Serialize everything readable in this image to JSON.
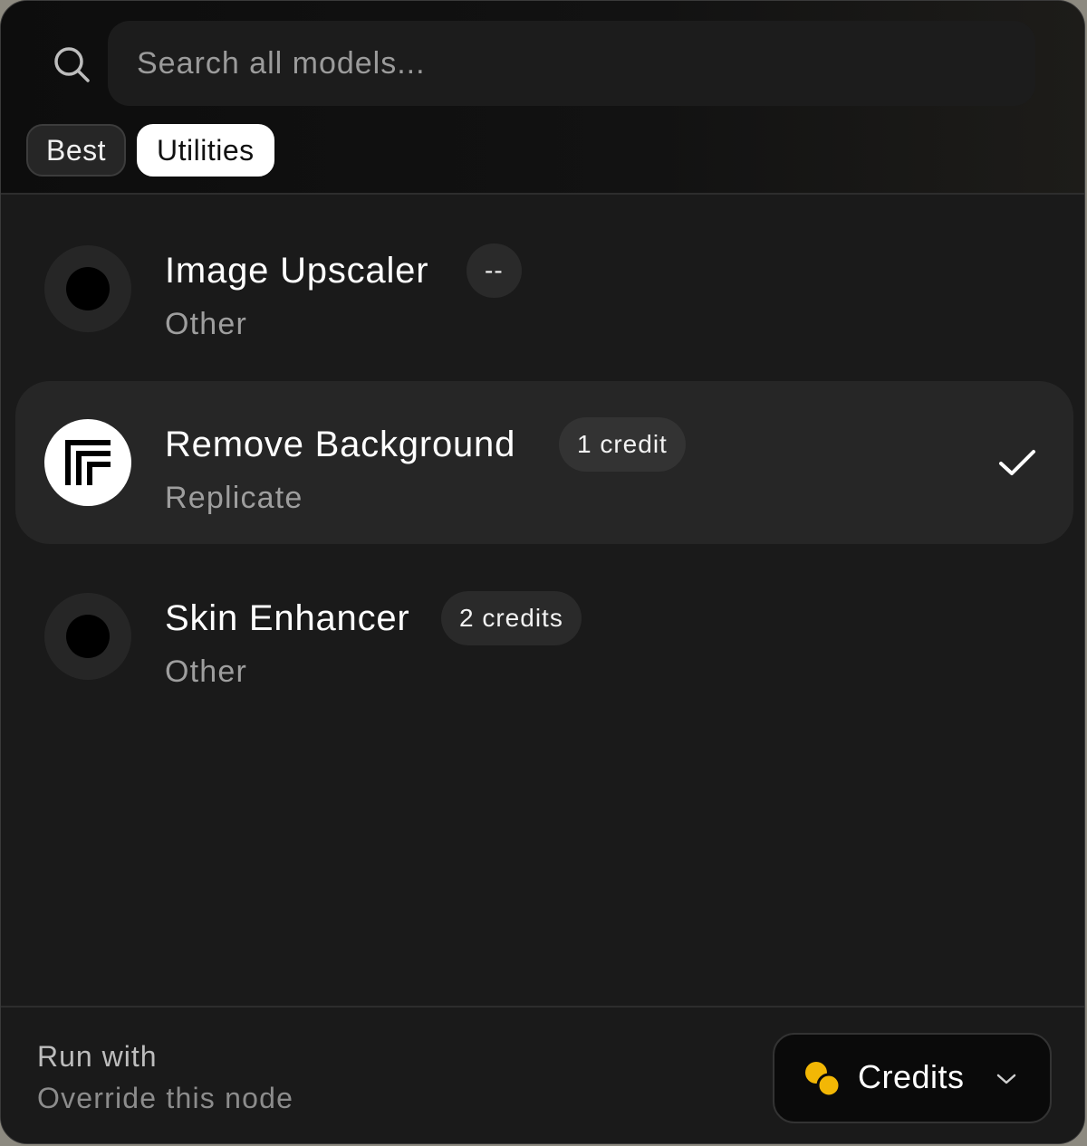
{
  "search": {
    "placeholder": "Search all models..."
  },
  "tabs": [
    {
      "label": "Best",
      "active": false
    },
    {
      "label": "Utilities",
      "active": true
    }
  ],
  "models": [
    {
      "name": "Image Upscaler",
      "badge": "--",
      "provider": "Other",
      "icon": "placeholder-dot-icon",
      "selected": false
    },
    {
      "name": "Remove Background",
      "badge": "1 credit",
      "provider": "Replicate",
      "icon": "replicate-logo-icon",
      "selected": true
    },
    {
      "name": "Skin Enhancer",
      "badge": "2 credits",
      "provider": "Other",
      "icon": "placeholder-dot-icon",
      "selected": false
    }
  ],
  "footer": {
    "run_with": "Run with",
    "override": "Override this node",
    "credits_label": "Credits"
  },
  "colors": {
    "panel_bg": "#1a1a1a",
    "selected_row_bg": "#262626",
    "coin_color": "#f2b705",
    "active_tab_bg": "#ffffff"
  }
}
